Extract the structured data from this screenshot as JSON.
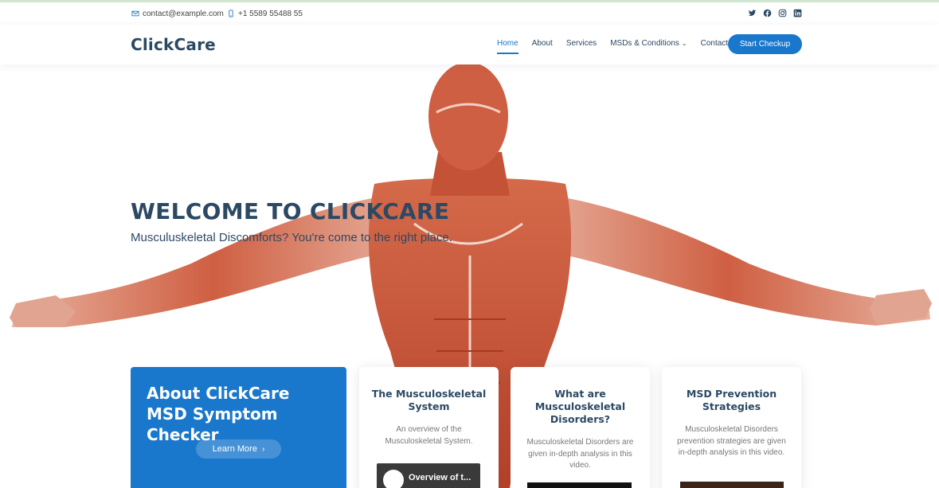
{
  "topbar": {
    "email": "contact@example.com",
    "phone": "+1 5589 55488 55",
    "email_icon": "envelope-icon",
    "phone_icon": "phone-icon",
    "social": [
      "twitter-icon",
      "facebook-icon",
      "instagram-icon",
      "linkedin-icon"
    ]
  },
  "header": {
    "logo": "ClickCare",
    "nav": {
      "home": "Home",
      "about": "About",
      "services": "Services",
      "msds": "MSDs & Conditions",
      "contact": "Contact"
    },
    "cta": "Start Checkup"
  },
  "hero": {
    "title": "WELCOME TO CLICKCARE",
    "subtitle": "Musculuskeletal Discomforts? You're come to the right place."
  },
  "about_box": {
    "title": "About ClickCare MSD Symptom Checker",
    "button": "Learn More",
    "button_icon": "chevron-right-icon"
  },
  "cards": [
    {
      "title": "The Musculoskeletal System",
      "text": "An overview of the Musculoskeletal System.",
      "video_title": "Overview of t..."
    },
    {
      "title": "What are Musculoskeletal Disorders?",
      "text": "Musculoskeletal Disorders are given in-depth analysis in this video."
    },
    {
      "title": "MSD Prevention Strategies",
      "text": "Musculoskeletal Disorders prevention strategies are given in-depth analysis in this video."
    }
  ],
  "colors": {
    "accent": "#1977cc",
    "heading": "#2c4964",
    "muscle": "#c9553a"
  }
}
